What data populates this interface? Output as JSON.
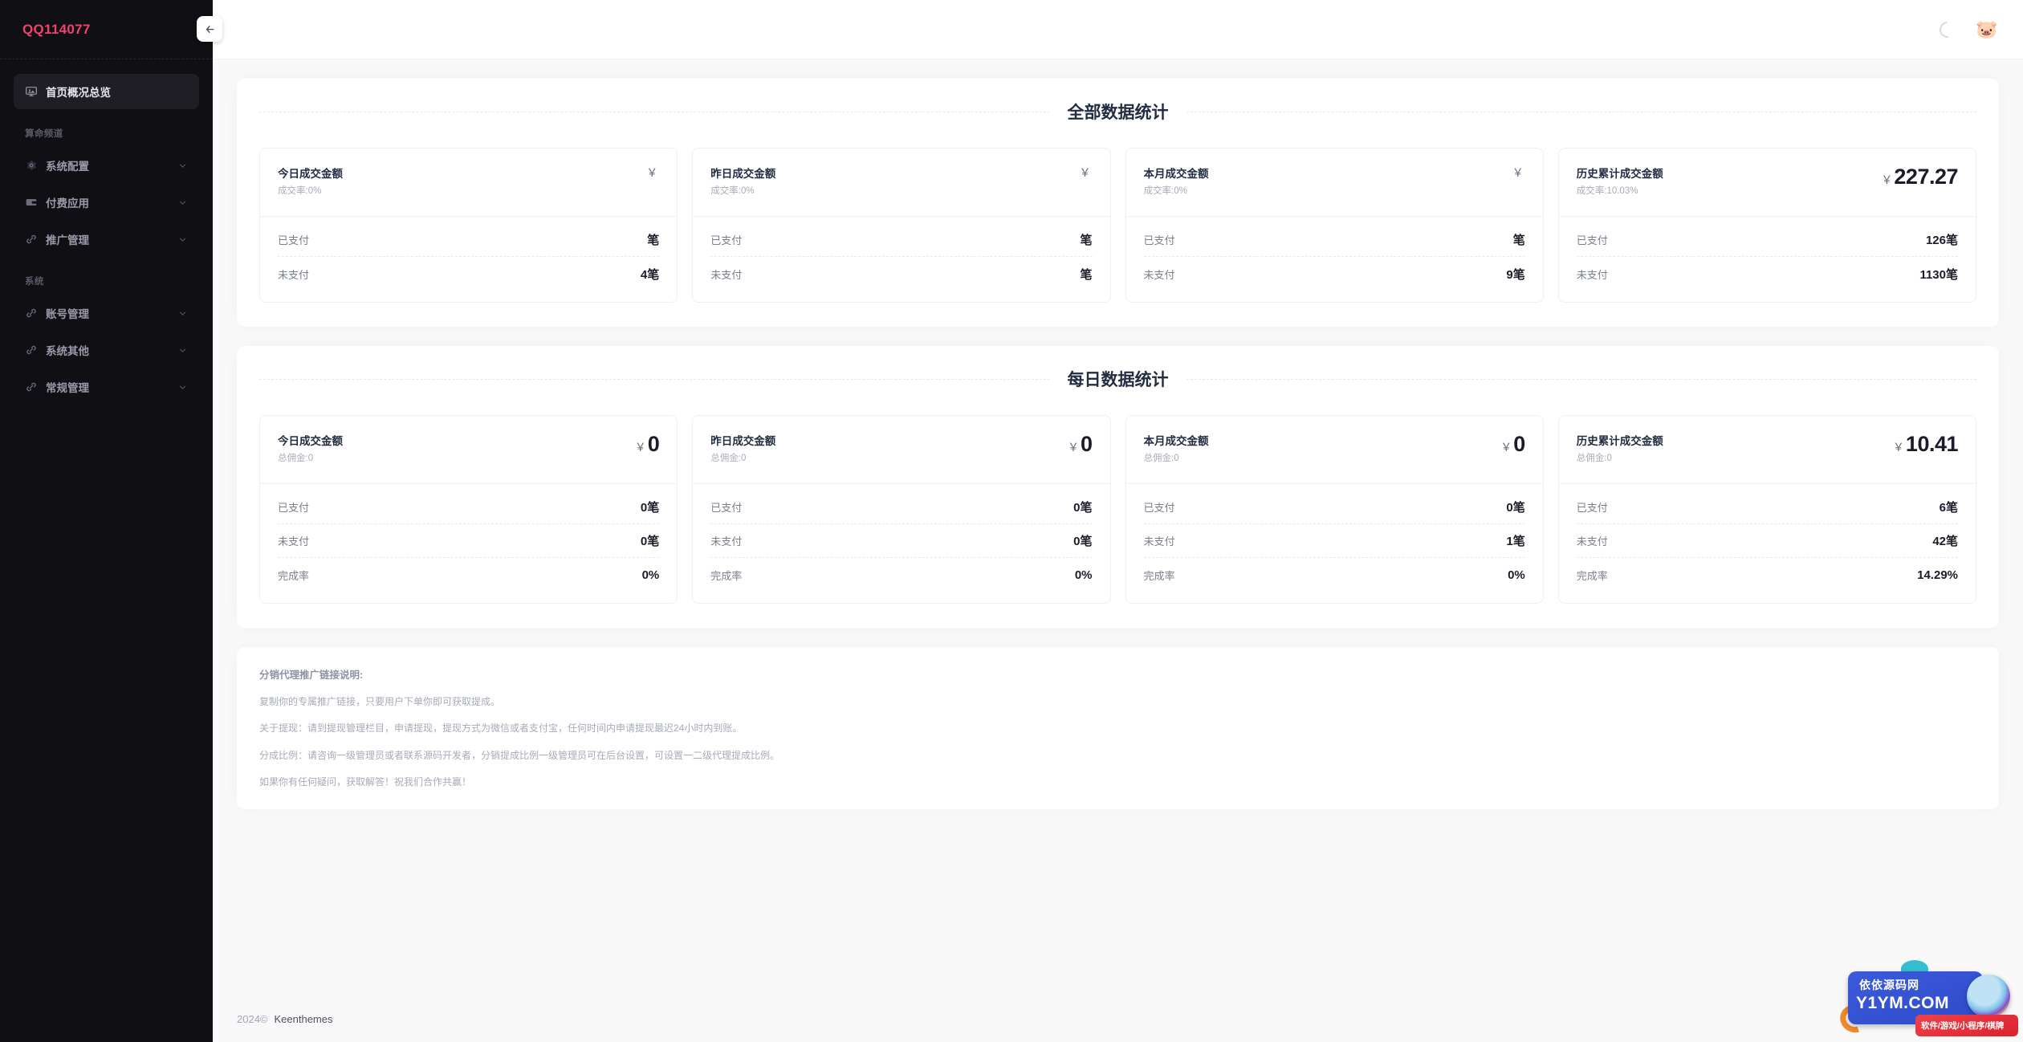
{
  "sidebar": {
    "logo": "QQ114077",
    "collapse_icon": "arrow-left-icon",
    "home_item": {
      "label": "首页概况总览",
      "icon": "monitor-icon"
    },
    "groups": [
      {
        "title": "算命频道",
        "items": [
          {
            "label": "系统配置",
            "icon": "gear-icon"
          },
          {
            "label": "付费应用",
            "icon": "wallet-icon"
          },
          {
            "label": "推广管理",
            "icon": "link-icon"
          }
        ]
      },
      {
        "title": "系统",
        "items": [
          {
            "label": "账号管理",
            "icon": "link-icon"
          },
          {
            "label": "系统其他",
            "icon": "link-icon"
          },
          {
            "label": "常规管理",
            "icon": "link-icon"
          }
        ]
      }
    ]
  },
  "topbar": {
    "spinner": "loading-spinner-icon",
    "avatar": "🐷"
  },
  "sections": [
    {
      "title": "全部数据统计",
      "cards": [
        {
          "title": "今日成交金额",
          "sub": "成交率:0%",
          "currency": "￥",
          "amount": "",
          "rows": [
            {
              "label": "已支付",
              "value": "笔"
            },
            {
              "label": "未支付",
              "value": "4笔"
            }
          ]
        },
        {
          "title": "昨日成交金额",
          "sub": "成交率:0%",
          "currency": "￥",
          "amount": "",
          "rows": [
            {
              "label": "已支付",
              "value": "笔"
            },
            {
              "label": "未支付",
              "value": "笔"
            }
          ]
        },
        {
          "title": "本月成交金额",
          "sub": "成交率:0%",
          "currency": "￥",
          "amount": "",
          "rows": [
            {
              "label": "已支付",
              "value": "笔"
            },
            {
              "label": "未支付",
              "value": "9笔"
            }
          ]
        },
        {
          "title": "历史累计成交金额",
          "sub": "成交率:10.03%",
          "currency": "￥",
          "amount": "227.27",
          "rows": [
            {
              "label": "已支付",
              "value": "126笔"
            },
            {
              "label": "未支付",
              "value": "1130笔"
            }
          ]
        }
      ]
    },
    {
      "title": "每日数据统计",
      "cards": [
        {
          "title": "今日成交金额",
          "sub": "总佣金:0",
          "currency": "￥",
          "amount": "0",
          "rows": [
            {
              "label": "已支付",
              "value": "0笔"
            },
            {
              "label": "未支付",
              "value": "0笔"
            },
            {
              "label": "完成率",
              "value": "0%"
            }
          ]
        },
        {
          "title": "昨日成交金额",
          "sub": "总佣金:0",
          "currency": "￥",
          "amount": "0",
          "rows": [
            {
              "label": "已支付",
              "value": "0笔"
            },
            {
              "label": "未支付",
              "value": "0笔"
            },
            {
              "label": "完成率",
              "value": "0%"
            }
          ]
        },
        {
          "title": "本月成交金额",
          "sub": "总佣金:0",
          "currency": "￥",
          "amount": "0",
          "rows": [
            {
              "label": "已支付",
              "value": "0笔"
            },
            {
              "label": "未支付",
              "value": "1笔"
            },
            {
              "label": "完成率",
              "value": "0%"
            }
          ]
        },
        {
          "title": "历史累计成交金额",
          "sub": "总佣金:0",
          "currency": "￥",
          "amount": "10.41",
          "rows": [
            {
              "label": "已支付",
              "value": "6笔"
            },
            {
              "label": "未支付",
              "value": "42笔"
            },
            {
              "label": "完成率",
              "value": "14.29%"
            }
          ]
        }
      ]
    }
  ],
  "notes": {
    "title": "分销代理推广链接说明:",
    "lines": [
      "复制你的专属推广链接，只要用户下单你即可获取提成。",
      "关于提现：请到提现管理栏目，申请提现，提现方式为微信或者支付宝，任何时间内申请提现最迟24小时内到账。",
      "分成比例：请咨询一级管理员或者联系源码开发者，分销提成比例一级管理员可在后台设置，可设置一二级代理提成比例。",
      "如果你有任何疑问，获取解答！祝我们合作共赢！"
    ]
  },
  "footer": {
    "year": "2024©",
    "brand": "Keenthemes"
  },
  "watermark": {
    "cn": "依依源码网",
    "domain": "Y1YM.COM",
    "tags": "软件/游戏/小程序/棋牌"
  },
  "colors": {
    "brand": "#f1416c",
    "sidebar_bg": "#101014",
    "page_bg": "#f9f9f9",
    "heading": "#232d42"
  }
}
